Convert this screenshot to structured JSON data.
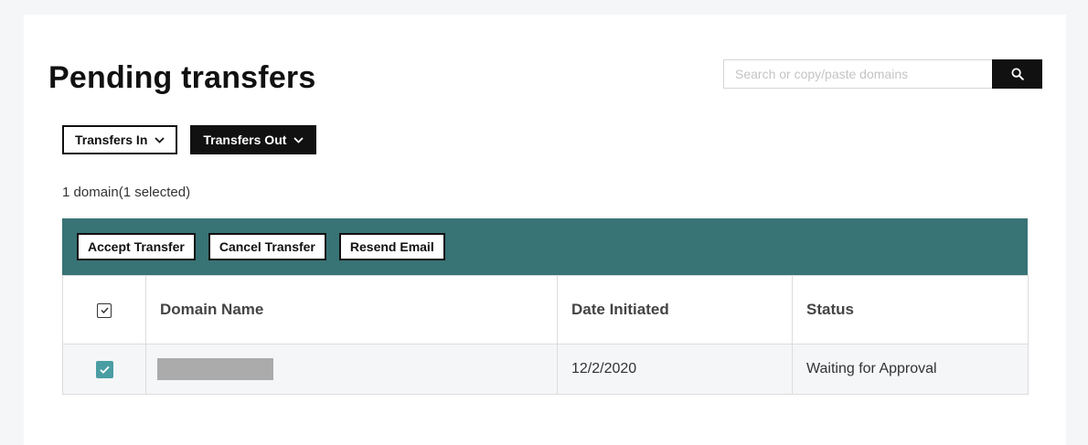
{
  "page": {
    "title": "Pending transfers"
  },
  "search": {
    "placeholder": "Search or copy/paste domains",
    "button_icon": "search-icon"
  },
  "filters": [
    {
      "label": "Transfers In",
      "style": "outline",
      "icon": "chevron-down-icon"
    },
    {
      "label": "Transfers Out",
      "style": "filled",
      "icon": "chevron-down-icon"
    }
  ],
  "selection": {
    "summary": "1 domain(1 selected)"
  },
  "actions": [
    {
      "label": "Accept Transfer"
    },
    {
      "label": "Cancel Transfer"
    },
    {
      "label": "Resend Email"
    }
  ],
  "table": {
    "columns": [
      "Domain Name",
      "Date Initiated",
      "Status"
    ],
    "header_checked": true,
    "rows": [
      {
        "checked": true,
        "domain": "",
        "date_initiated": "12/2/2020",
        "status": "Waiting for Approval"
      }
    ]
  },
  "colors": {
    "action_bar": "#387375",
    "checkbox_checked": "#4a9ea3",
    "page_background": "#f5f6f8",
    "primary_dark": "#111111"
  }
}
